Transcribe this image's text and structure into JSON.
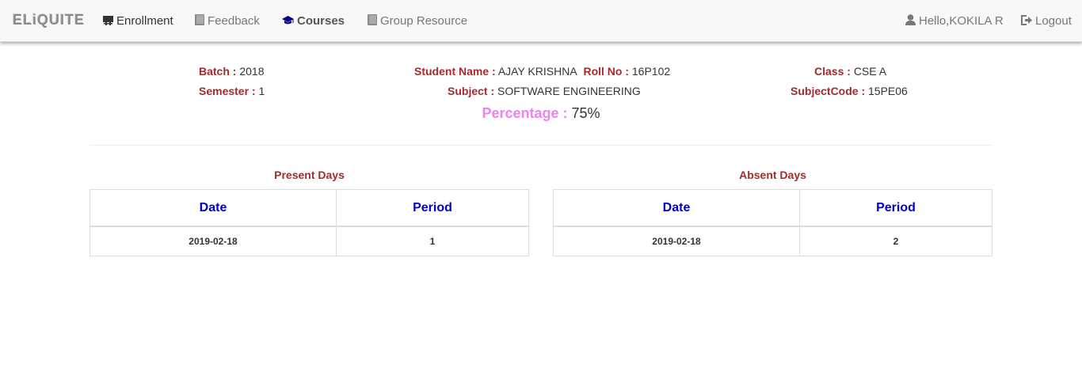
{
  "navbar": {
    "brand": "ELiQUITE",
    "items": [
      {
        "label": "Enrollment",
        "icon": "blackboard-icon"
      },
      {
        "label": "Feedback",
        "icon": "book-icon"
      },
      {
        "label": "Courses",
        "icon": "graduation-cap-icon"
      },
      {
        "label": "Group Resource",
        "icon": "book-icon"
      }
    ],
    "greeting": "Hello,KOKILA R",
    "logout": "Logout"
  },
  "info": {
    "batch_label": "Batch :",
    "batch": "2018",
    "semester_label": "Semester :",
    "semester": "1",
    "student_name_label": "Student Name :",
    "student_name": "AJAY KRISHNA",
    "roll_no_label": "Roll No :",
    "roll_no": "16P102",
    "subject_label": "Subject :",
    "subject": "SOFTWARE ENGINEERING",
    "class_label": "Class :",
    "class": "CSE A",
    "subject_code_label": "SubjectCode :",
    "subject_code": "15PE06",
    "percentage_label": "Percentage :",
    "percentage": "75%"
  },
  "present": {
    "title": "Present Days",
    "headers": [
      "Date",
      "Period"
    ],
    "rows": [
      [
        "2019-02-18",
        "1"
      ]
    ]
  },
  "absent": {
    "title": "Absent Days",
    "headers": [
      "Date",
      "Period"
    ],
    "rows": [
      [
        "2019-02-18",
        "2"
      ]
    ]
  },
  "colors": {
    "label": "#a52a2a",
    "percentage_label": "#ee82ee",
    "table_header": "#0000cd",
    "navbar_bg": "#f8f8f8"
  }
}
